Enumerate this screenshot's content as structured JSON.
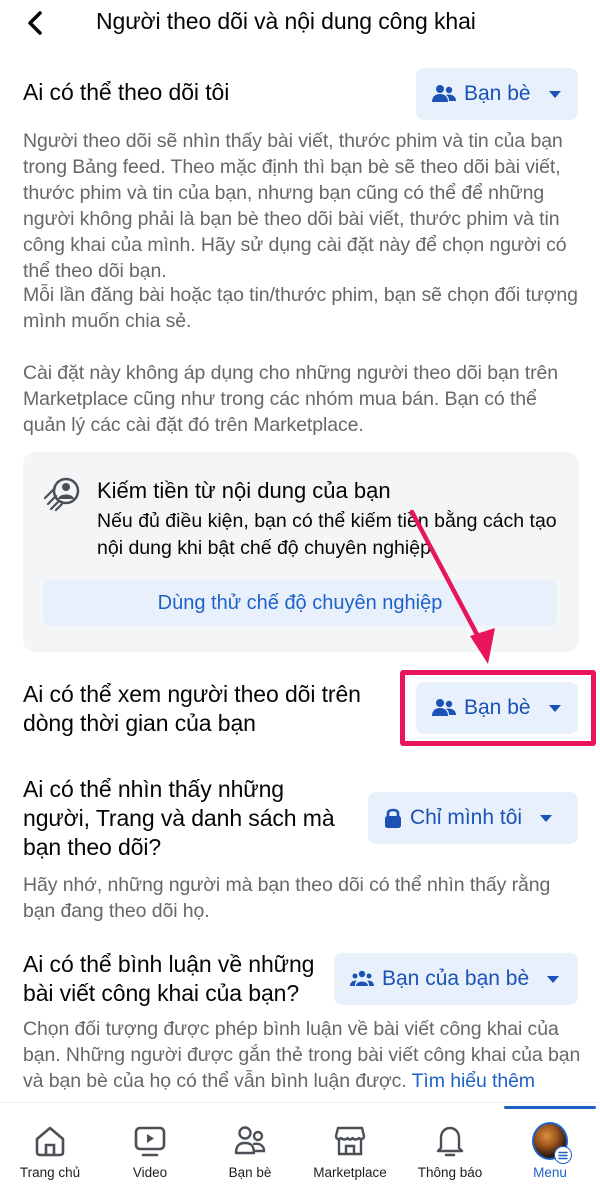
{
  "header": {
    "title": "Người theo dõi và nội dung công khai",
    "back_icon": "chevron-left-icon"
  },
  "section_followers": {
    "title": "Ai có thể theo dõi tôi",
    "dropdown": {
      "label": "Bạn bè",
      "icon": "friends-icon"
    },
    "desc1": "Người theo dõi sẽ nhìn thấy bài viết, thước phim và tin của bạn trong Bảng feed. Theo mặc định thì bạn bè sẽ theo dõi bài viết, thước phim và tin của bạn, nhưng bạn cũng có thể để những người không phải là bạn bè theo dõi bài viết, thước phim và tin công khai của mình. Hãy sử dụng cài đặt này để chọn người có thể theo dõi bạn.",
    "desc2": "Mỗi lần đăng bài hoặc tạo tin/thước phim, bạn sẽ chọn đối tượng mình muốn chia sẻ.",
    "desc3": "Cài đặt này không áp dụng cho những người theo dõi bạn trên Marketplace cũng như trong các nhóm mua bán. Bạn có thể quản lý các cài đặt đó trên Marketplace."
  },
  "promo": {
    "icon": "professional-mode-icon",
    "title": "Kiếm tiền từ nội dung của bạn",
    "text": "Nếu đủ điều kiện, bạn có thể kiếm tiền bằng cách tạo nội dung khi bật chế độ chuyên nghiệp.",
    "button_label": "Dùng thử chế độ chuyên nghiệp"
  },
  "section_timeline": {
    "title_line1": "Ai có thể xem người theo dõi trên",
    "title_line2": "dòng thời gian của bạn",
    "dropdown": {
      "label": "Bạn bè",
      "icon": "friends-icon"
    }
  },
  "section_following": {
    "title_line1": "Ai có thể nhìn thấy những",
    "title_line2": "người, Trang và danh sách mà",
    "title_line3": "bạn theo dõi?",
    "dropdown": {
      "label": "Chỉ mình tôi",
      "icon": "lock-icon"
    },
    "desc": "Hãy nhớ, những người mà bạn theo dõi có thể nhìn thấy rằng bạn đang theo dõi họ."
  },
  "section_comments": {
    "title_line1": "Ai có thể bình luận về những",
    "title_line2": "bài viết công khai của bạn?",
    "dropdown": {
      "label": "Bạn của bạn bè",
      "icon": "friends-of-friends-icon"
    },
    "desc": "Chọn đối tượng được phép bình luận về bài viết công khai của bạn. Những người được gắn thẻ trong bài viết công khai của bạn và bạn bè của họ có thể vẫn bình luận được.",
    "learn_more": "Tìm hiểu thêm"
  },
  "annotation": {
    "color": "#e8155a",
    "type": "arrow-and-box"
  },
  "tabbar": {
    "active_index": 5,
    "tabs": [
      {
        "label": "Trang chủ",
        "icon": "home-icon"
      },
      {
        "label": "Video",
        "icon": "video-icon"
      },
      {
        "label": "Bạn bè",
        "icon": "friends-icon"
      },
      {
        "label": "Marketplace",
        "icon": "marketplace-icon"
      },
      {
        "label": "Thông báo",
        "icon": "bell-icon"
      },
      {
        "label": "Menu",
        "icon": "profile-avatar-menu-icon"
      }
    ]
  },
  "colors": {
    "accent": "#1c52b5",
    "dropdown_bg": "#e7f0fb",
    "secondary_text": "#65676b",
    "annotation_red": "#e8155a"
  }
}
